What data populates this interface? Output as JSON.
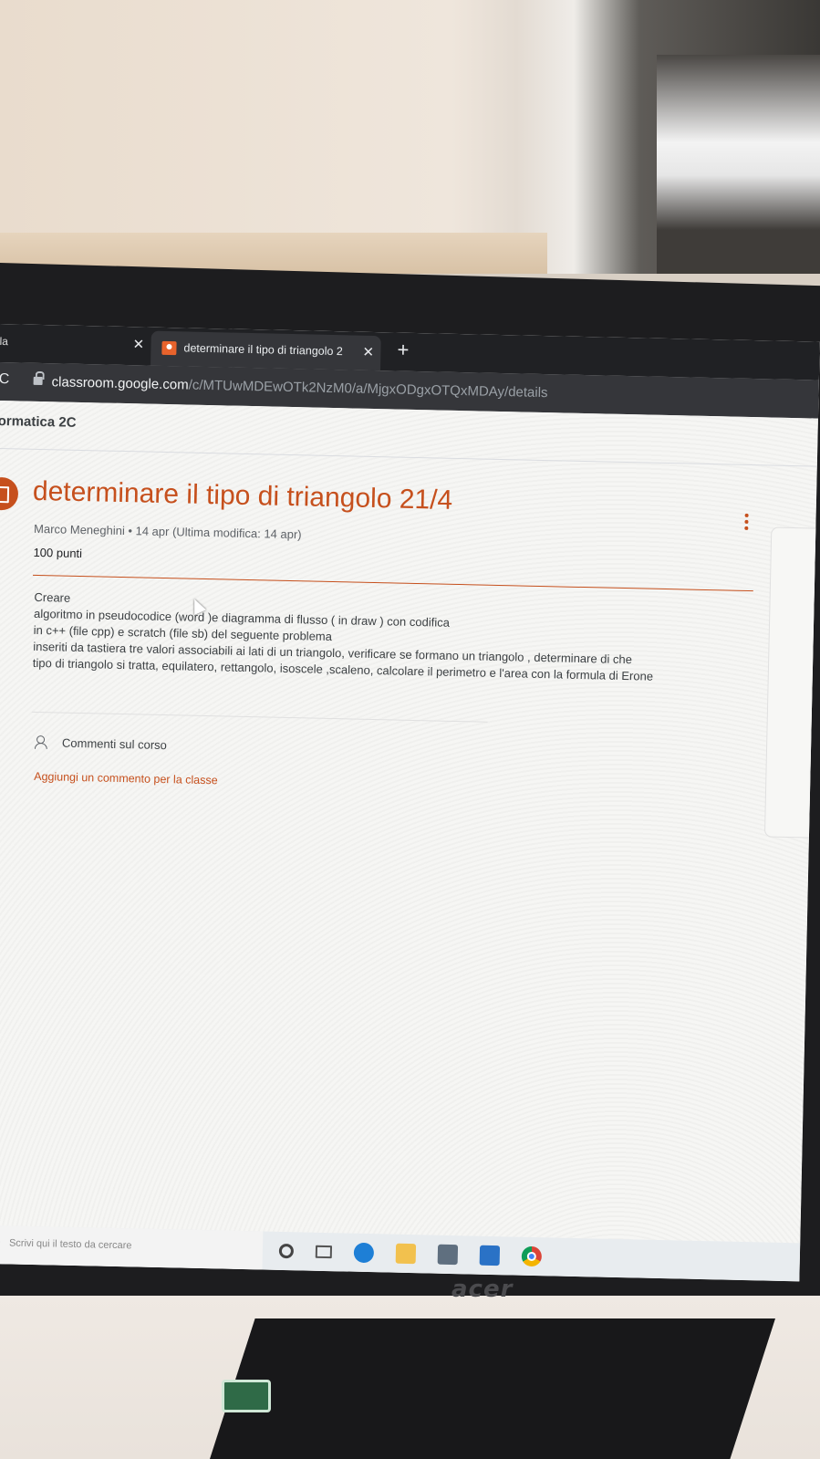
{
  "browser": {
    "left_tab_partial": "la",
    "active_tab_title": "determinare il tipo di triangolo 2",
    "close_glyph": "✕",
    "new_tab_glyph": "+",
    "reload_glyph": "C",
    "url_host": "classroom.google.com",
    "url_path": "/c/MTUwMDEwOTk2NzM0/a/MjgxODgxOTQxMDAy/details"
  },
  "classroom": {
    "class_name": "ormatica 2C",
    "assignment_title": "determinare il tipo di triangolo  21/4",
    "meta": "Marco Meneghini • 14 apr (Ultima modifica: 14 apr)",
    "points": "100 punti",
    "description_lines": [
      "Creare",
      "algoritmo in pseudocodice (word )e diagramma di flusso ( in draw ) con codifica",
      "in c++ (file cpp) e scratch (file sb) del seguente problema",
      "inseriti da tastiera tre valori associabili ai lati di un triangolo, verificare se formano un triangolo , determinare di che",
      "tipo di triangolo si tratta, equilatero, rettangolo, isoscele ,scaleno, calcolare il perimetro e l'area con la formula di Erone"
    ],
    "comments_label": "Commenti sul corso",
    "add_comment": "Aggiungi un commento per la classe"
  },
  "taskbar": {
    "search_placeholder": "Scrivi qui il testo da cercare",
    "icons": [
      "cortana-icon",
      "task-view-icon",
      "edge-icon",
      "file-explorer-icon",
      "store-icon",
      "mail-icon",
      "chrome-icon"
    ]
  },
  "monitor": {
    "brand": "acer"
  },
  "colors": {
    "accent": "#c6501d",
    "tabbar": "#202124",
    "toolbar": "#35363a"
  }
}
